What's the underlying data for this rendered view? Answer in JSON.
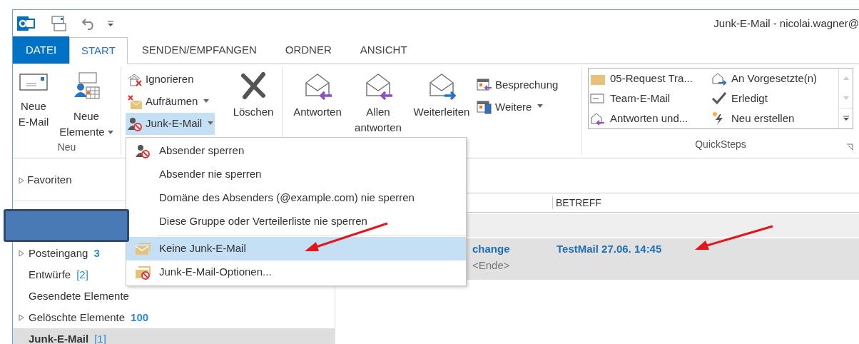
{
  "window": {
    "title": "Junk-E-Mail - nicolai.wagner@"
  },
  "tabs": [
    {
      "label": "DATEI",
      "kind": "file",
      "selected": false
    },
    {
      "label": "START",
      "kind": "tab",
      "selected": true
    },
    {
      "label": "SENDEN/EMPFANGEN",
      "kind": "tab",
      "selected": false
    },
    {
      "label": "ORDNER",
      "kind": "tab",
      "selected": false
    },
    {
      "label": "ANSICHT",
      "kind": "tab",
      "selected": false
    }
  ],
  "ribbon": {
    "new_group": {
      "label": "Neu",
      "buttons": [
        {
          "label": "Neue E-Mail",
          "dropdown": false
        },
        {
          "label": "Neue Elemente",
          "dropdown": true
        }
      ]
    },
    "delete_group": {
      "small_buttons": [
        {
          "label": "Ignorieren",
          "dropdown": false,
          "open": false
        },
        {
          "label": "Aufräumen",
          "dropdown": true,
          "open": false
        },
        {
          "label": "Junk-E-Mail",
          "dropdown": true,
          "open": true
        }
      ],
      "delete_button": {
        "label": "Löschen"
      }
    },
    "respond_group": {
      "buttons": [
        {
          "label": "Antworten"
        },
        {
          "label": "Allen antworten"
        },
        {
          "label": "Weiterleiten"
        }
      ],
      "small_buttons": [
        {
          "label": "Besprechung",
          "dropdown": false
        },
        {
          "label": "Weitere",
          "dropdown": true
        }
      ]
    },
    "quicksteps": {
      "label": "QuickSteps",
      "items": [
        {
          "label": "05-Request Tra..."
        },
        {
          "label": "An Vorgesetzte(n)"
        },
        {
          "label": "Team-E-Mail"
        },
        {
          "label": "Erledigt"
        },
        {
          "label": "Antworten und..."
        },
        {
          "label": "Neu erstellen"
        }
      ]
    }
  },
  "menu": {
    "items": [
      {
        "label": "Absender sperren",
        "kind": "block-sender",
        "selected": false
      },
      {
        "label": "Absender nie sperren",
        "kind": "plain",
        "selected": false
      },
      {
        "label": "Domäne des Absenders (@example.com) nie sperren",
        "kind": "plain",
        "selected": false
      },
      {
        "label": "Diese Gruppe oder Verteilerliste nie sperren",
        "kind": "plain",
        "selected": false
      },
      {
        "label": "Keine Junk-E-Mail",
        "kind": "not-junk",
        "selected": true
      },
      {
        "label": "Junk-E-Mail-Optionen...",
        "kind": "options",
        "selected": false
      }
    ]
  },
  "sidebar": {
    "favorites": {
      "label": "Favoriten",
      "expanded": false
    },
    "folders": [
      {
        "label": "Posteingang",
        "count": "3",
        "count_bold": true,
        "collapsible": true,
        "selected": false
      },
      {
        "label": "Entwürfe",
        "count": "[2]",
        "count_bold": false,
        "collapsible": false,
        "selected": false
      },
      {
        "label": "Gesendete Elemente",
        "collapsible": false,
        "selected": false
      },
      {
        "label": "Gelöschte Elemente",
        "count": "100",
        "count_bold": true,
        "collapsible": true,
        "selected": false
      },
      {
        "label": "Junk-E-Mail",
        "count": "[1]",
        "count_bold": false,
        "collapsible": false,
        "selected": true
      }
    ]
  },
  "mail_list": {
    "columns": [
      "BETREFF"
    ],
    "messages": [
      {
        "sender": "change",
        "subject": "TestMail 27.06. 14:45",
        "preview": "<Ende>",
        "unread": true,
        "selected": true
      }
    ]
  }
}
